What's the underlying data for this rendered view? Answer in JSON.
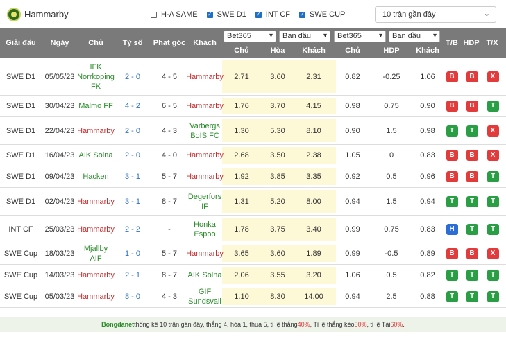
{
  "header": {
    "team_name": "Hammarby",
    "filters": [
      {
        "label": "H-A SAME",
        "checked": false
      },
      {
        "label": "SWE D1",
        "checked": true
      },
      {
        "label": "INT CF",
        "checked": true
      },
      {
        "label": "SWE CUP",
        "checked": true
      }
    ],
    "range_selected": "10 trận gần đây"
  },
  "columns": {
    "league": "Giải đấu",
    "date": "Ngày",
    "home": "Chủ",
    "score": "Tỷ số",
    "corners": "Phạt góc",
    "away": "Khách",
    "bookmaker1": "Bet365",
    "period1": "Ban đầu",
    "bookmaker2": "Bet365",
    "period2": "Ban đầu",
    "odds_home": "Chủ",
    "odds_draw": "Hòa",
    "odds_away": "Khách",
    "hdp_home": "Chủ",
    "hdp": "HDP",
    "hdp_away": "Khách",
    "tb": "T/B",
    "hdp_result": "HDP",
    "tx": "T/X"
  },
  "matches": [
    {
      "league": "SWE D1",
      "date": "05/05/23",
      "home": "IFK Norrkoping FK",
      "score": "2 - 0",
      "corners": "4 - 5",
      "away": "Hammarby",
      "h": "2.71",
      "d": "3.60",
      "a": "2.31",
      "hh": "0.82",
      "hdp": "-0.25",
      "ha": "1.06",
      "tb": "B",
      "hr": "B",
      "tx": "X"
    },
    {
      "league": "SWE D1",
      "date": "30/04/23",
      "home": "Malmo FF",
      "score": "4 - 2",
      "corners": "6 - 5",
      "away": "Hammarby",
      "h": "1.76",
      "d": "3.70",
      "a": "4.15",
      "hh": "0.98",
      "hdp": "0.75",
      "ha": "0.90",
      "tb": "B",
      "hr": "B",
      "tx": "T"
    },
    {
      "league": "SWE D1",
      "date": "22/04/23",
      "home": "Hammarby",
      "score": "2 - 0",
      "corners": "4 - 3",
      "away": "Varbergs BoIS FC",
      "h": "1.30",
      "d": "5.30",
      "a": "8.10",
      "hh": "0.90",
      "hdp": "1.5",
      "ha": "0.98",
      "tb": "T",
      "hr": "T",
      "tx": "X"
    },
    {
      "league": "SWE D1",
      "date": "16/04/23",
      "home": "AIK Solna",
      "score": "2 - 0",
      "corners": "4 - 0",
      "away": "Hammarby",
      "h": "2.68",
      "d": "3.50",
      "a": "2.38",
      "hh": "1.05",
      "hdp": "0",
      "ha": "0.83",
      "tb": "B",
      "hr": "B",
      "tx": "X"
    },
    {
      "league": "SWE D1",
      "date": "09/04/23",
      "home": "Hacken",
      "score": "3 - 1",
      "corners": "5 - 7",
      "away": "Hammarby",
      "h": "1.92",
      "d": "3.85",
      "a": "3.35",
      "hh": "0.92",
      "hdp": "0.5",
      "ha": "0.96",
      "tb": "B",
      "hr": "B",
      "tx": "T"
    },
    {
      "league": "SWE D1",
      "date": "02/04/23",
      "home": "Hammarby",
      "score": "3 - 1",
      "corners": "8 - 7",
      "away": "Degerfors IF",
      "h": "1.31",
      "d": "5.20",
      "a": "8.00",
      "hh": "0.94",
      "hdp": "1.5",
      "ha": "0.94",
      "tb": "T",
      "hr": "T",
      "tx": "T"
    },
    {
      "league": "INT CF",
      "date": "25/03/23",
      "home": "Hammarby",
      "score": "2 - 2",
      "corners": "-",
      "away": "Honka Espoo",
      "h": "1.78",
      "d": "3.75",
      "a": "3.40",
      "hh": "0.99",
      "hdp": "0.75",
      "ha": "0.83",
      "tb": "H",
      "hr": "T",
      "tx": "T"
    },
    {
      "league": "SWE Cup",
      "date": "18/03/23",
      "home": "Mjallby AIF",
      "score": "1 - 0",
      "corners": "5 - 7",
      "away": "Hammarby",
      "h": "3.65",
      "d": "3.60",
      "a": "1.89",
      "hh": "0.99",
      "hdp": "-0.5",
      "ha": "0.89",
      "tb": "B",
      "hr": "B",
      "tx": "X"
    },
    {
      "league": "SWE Cup",
      "date": "14/03/23",
      "home": "Hammarby",
      "score": "2 - 1",
      "corners": "8 - 7",
      "away": "AIK Solna",
      "h": "2.06",
      "d": "3.55",
      "a": "3.20",
      "hh": "1.06",
      "hdp": "0.5",
      "ha": "0.82",
      "tb": "T",
      "hr": "T",
      "tx": "T"
    },
    {
      "league": "SWE Cup",
      "date": "05/03/23",
      "home": "Hammarby",
      "score": "8 - 0",
      "corners": "4 - 3",
      "away": "GIF Sundsvall",
      "h": "1.10",
      "d": "8.30",
      "a": "14.00",
      "hh": "0.94",
      "hdp": "2.5",
      "ha": "0.88",
      "tb": "T",
      "hr": "T",
      "tx": "T"
    }
  ],
  "footer": {
    "brand": "Bongdanet",
    "text1": " thống kê 10 trận gần đây, thắng 4, hòa 1, thua 5, tỉ lệ thắng ",
    "win_pct": "40%",
    "text2": ", Tỉ lệ thắng kèo ",
    "hdp_pct": "50%",
    "text3": ", tỉ lệ Tài ",
    "over_pct": "60%",
    "text4": "."
  },
  "colors": {
    "header_bg": "#7a7a7a",
    "odds_highlight": "#fdf8d6",
    "win": "#2a9e44",
    "lose": "#e23b3b",
    "draw": "#2c6ed6",
    "team_highlight": "#c62d2d",
    "link_green": "#2a8c2a",
    "score_blue": "#2d6fc7"
  }
}
